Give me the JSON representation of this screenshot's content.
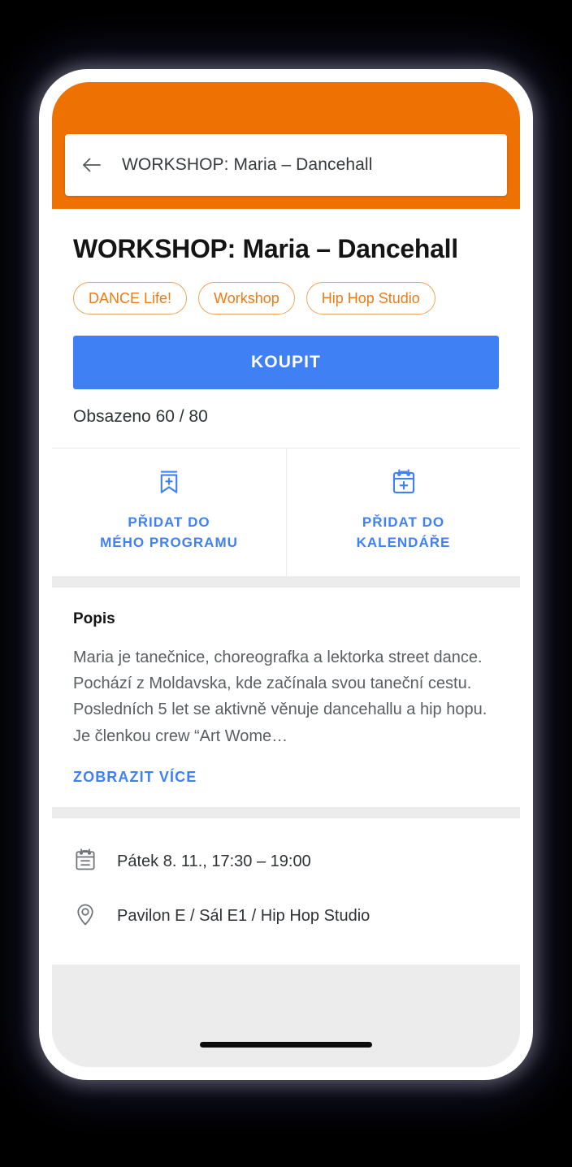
{
  "theme": {
    "orange": "#EE7203",
    "blue": "#4080F5",
    "chip_border": "#F0A45C",
    "chip_text": "#EF7B14",
    "gray_spacer": "#ECECEC"
  },
  "appbar": {
    "back_icon": "arrow-left-icon",
    "title": "WORKSHOP: Maria – Dancehall"
  },
  "event": {
    "title": "WORKSHOP: Maria – Dancehall",
    "chips": [
      {
        "label": "DANCE Life!"
      },
      {
        "label": "Workshop"
      },
      {
        "label": "Hip Hop Studio"
      }
    ],
    "buy_button": "KOUPIT",
    "occupancy": "Obsazeno 60 / 80"
  },
  "actions": [
    {
      "icon": "bookmark-plus-icon",
      "label": "PŘIDAT DO\nMÉHO PROGRAMU"
    },
    {
      "icon": "calendar-plus-icon",
      "label": "PŘIDAT DO\nKALENDÁŘE"
    }
  ],
  "description": {
    "heading": "Popis",
    "body": "Maria je tanečnice, choreografka a lektorka street dance. Pochází z Moldavska, kde začínala svou taneční cestu. Posledních 5 let se aktivně věnuje dancehallu a hip hopu. Je členkou crew “Art Wome…",
    "show_more": "ZOBRAZIT VÍCE"
  },
  "info_rows": [
    {
      "icon": "calendar-icon",
      "text": "Pátek 8. 11., 17:30 – 19:00"
    },
    {
      "icon": "location-pin-icon",
      "text": "Pavilon E / Sál E1 / Hip Hop Studio"
    }
  ]
}
